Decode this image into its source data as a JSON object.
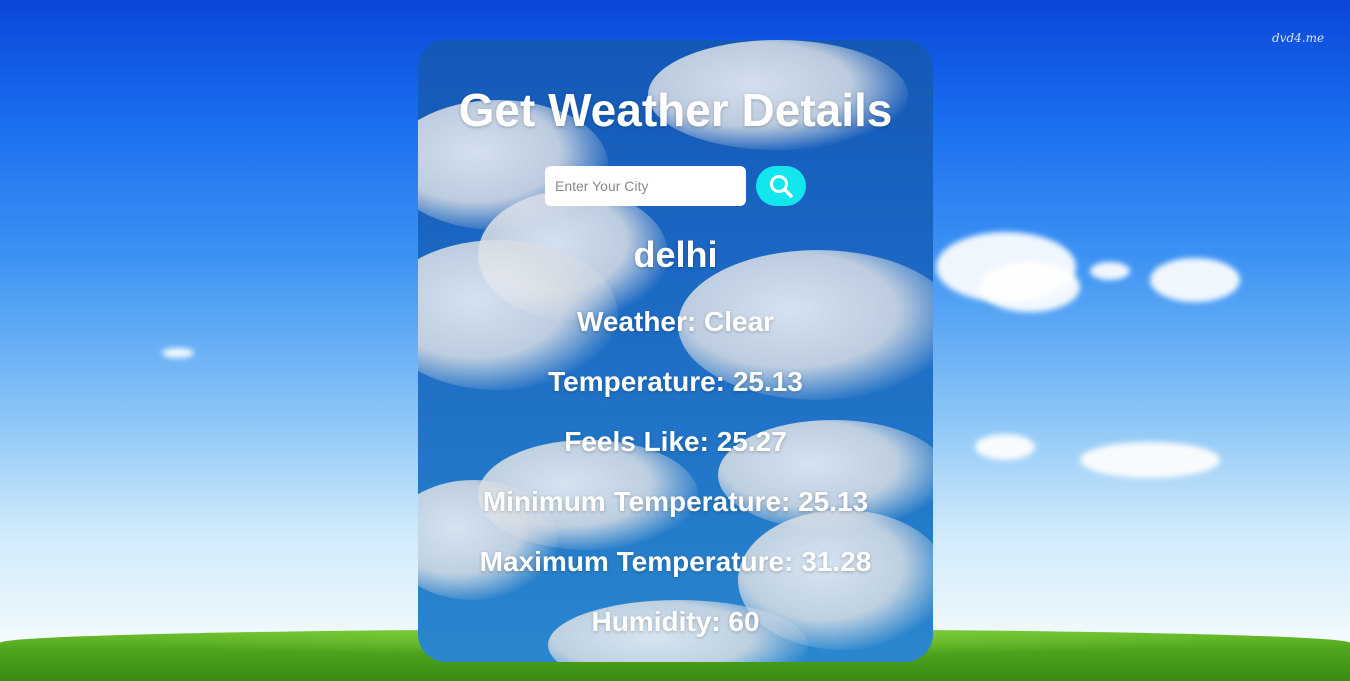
{
  "background": {
    "watermark": "dvd4.me"
  },
  "card": {
    "title": "Get Weather Details",
    "search": {
      "placeholder": "Enter Your City",
      "value": "",
      "button_icon": "search-icon"
    },
    "city": "delhi",
    "details": [
      "Weather: Clear",
      "Temperature: 25.13",
      "Feels Like: 25.27",
      "Minimum Temperature: 25.13",
      "Maximum Temperature: 31.28",
      "Humidity: 60"
    ]
  },
  "colors": {
    "search_button": "#14e6ee",
    "text": "#ffffff",
    "card_blue": "#1b67c3"
  }
}
